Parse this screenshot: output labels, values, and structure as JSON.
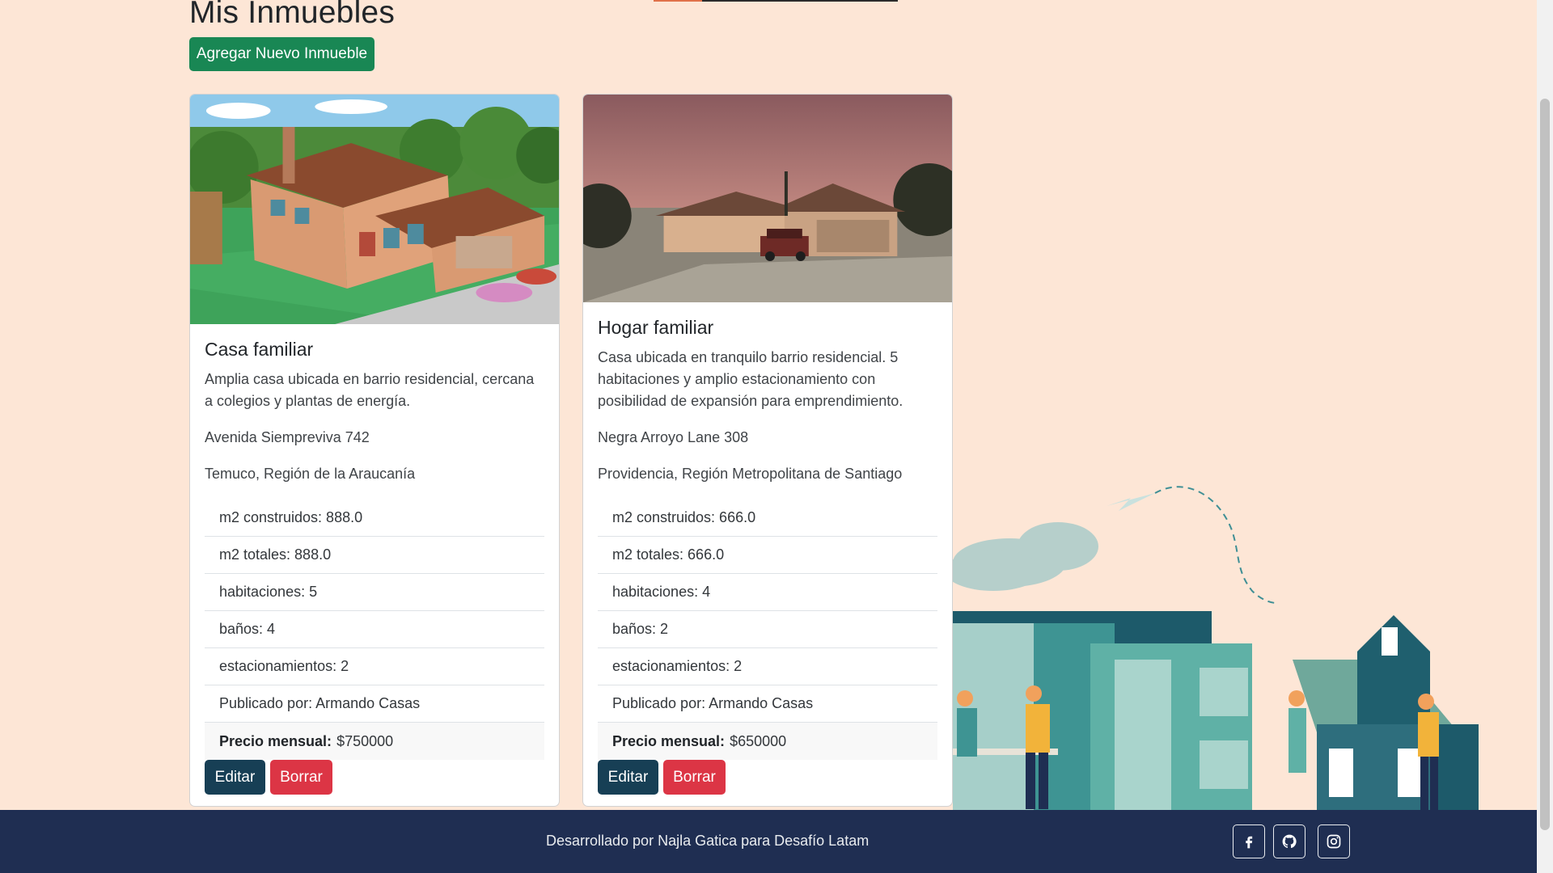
{
  "page": {
    "title": "Mis Inmuebles",
    "add_button": "Agregar Nuevo Inmueble"
  },
  "properties": [
    {
      "name": "Casa familiar",
      "description": "Amplia casa ubicada en barrio residencial, cercana a colegios y plantas de energía.",
      "address": "Avenida Siempreviva 742",
      "location": "Temuco, Región de la Araucanía",
      "m2_built": "m2 construidos: 888.0",
      "m2_total": "m2 totales: 888.0",
      "rooms": "habitaciones: 5",
      "baths": "baños: 4",
      "parking": "estacionamientos: 2",
      "published_by": "Publicado por: Armando Casas",
      "price_label": "Precio mensual:",
      "price": "$750000",
      "edit": "Editar",
      "delete": "Borrar"
    },
    {
      "name": "Hogar familiar",
      "description": "Casa ubicada en tranquilo barrio residencial. 5 habitaciones y amplio estacionamiento con posibilidad de expansión para emprendimiento.",
      "address": "Negra Arroyo Lane 308",
      "location": "Providencia, Región Metropolitana de Santiago",
      "m2_built": "m2 construidos: 666.0",
      "m2_total": "m2 totales: 666.0",
      "rooms": "habitaciones: 4",
      "baths": "baños: 2",
      "parking": "estacionamientos: 2",
      "published_by": "Publicado por: Armando Casas",
      "price_label": "Precio mensual:",
      "price": "$650000",
      "edit": "Editar",
      "delete": "Borrar"
    }
  ],
  "footer": {
    "text": "Desarrollado por Najla Gatica para Desafío Latam",
    "social": [
      "facebook-icon",
      "github-icon",
      "instagram-icon"
    ]
  },
  "colors": {
    "background": "#fde6d6",
    "success": "#198754",
    "edit": "#173f55",
    "delete": "#dc3545",
    "footer": "#1f2e52"
  }
}
